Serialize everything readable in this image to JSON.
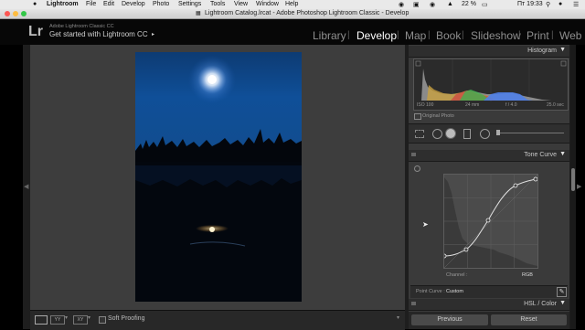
{
  "menubar": {
    "app": "Lightroom",
    "items": [
      "File",
      "Edit",
      "Develop",
      "Photo",
      "Settings",
      "Tools",
      "View",
      "Window",
      "Help"
    ],
    "battery": "22 %",
    "clock": "Пт 19:33"
  },
  "window": {
    "title": "Lightroom Catalog.lrcat - Adobe Photoshop Lightroom Classic - Develop"
  },
  "identity": {
    "logo": "Lr",
    "product": "Adobe Lightroom Classic CC",
    "tagline": "Get started with Lightroom CC",
    "arrow": "▸"
  },
  "modules": [
    "Library",
    "Develop",
    "Map",
    "Book",
    "Slideshow",
    "Print",
    "Web"
  ],
  "histogram": {
    "title": "Histogram",
    "iso": "ISO 100",
    "focal": "24 mm",
    "aperture": "f / 4.0",
    "shutter": "25.0 sec",
    "original_label": "Original Photo"
  },
  "tone_curve": {
    "title": "Tone Curve",
    "channel_label": "Channel :",
    "channel_value": "RGB",
    "point_curve_label": "Point Curve :",
    "point_curve_value": "Custom"
  },
  "hsl": {
    "title": "HSL / Color"
  },
  "buttons": {
    "previous": "Previous",
    "reset": "Reset"
  },
  "toolbar": {
    "soft_proofing": "Soft Proofing"
  },
  "colors": {
    "accent_active": "#ffffff",
    "module_inactive": "#8f8f8f"
  }
}
